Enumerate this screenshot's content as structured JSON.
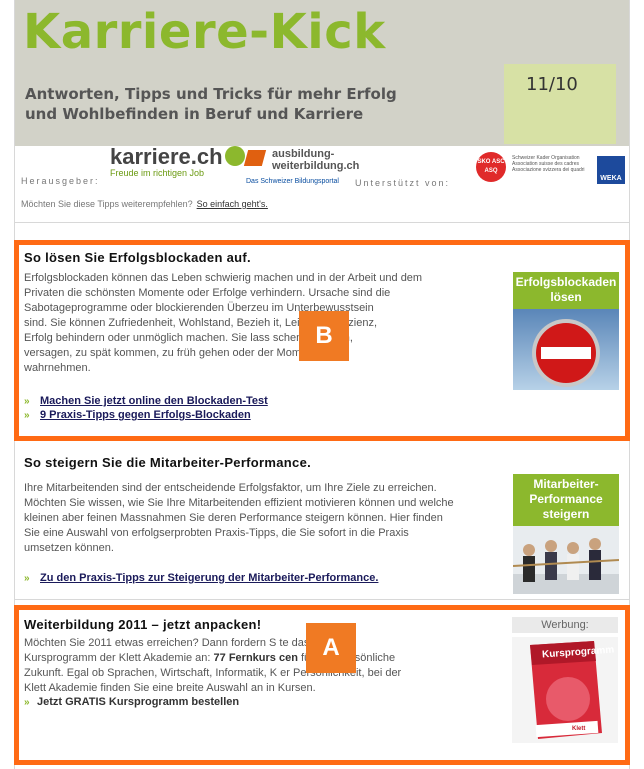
{
  "header": {
    "brand": "Karriere-Kick",
    "tagline_line1": "Antworten, Tipps und Tricks für mehr Erfolg",
    "tagline_line2": "und Wohlbefinden in Beruf und Karriere",
    "issue": "11/10"
  },
  "sponsors": {
    "publisher_label": "Herausgeber:",
    "karriere_name": "karriere.ch",
    "karriere_slogan": "Freude im richtigen Job",
    "ausbildung_line1": "ausbildung-",
    "ausbildung_line2": "weiterbildung.ch",
    "ausbildung_sub": "Das Schweizer Bildungsportal",
    "supported_label": "Unterstützt von:",
    "seal_text": "SKO ASC ASQ",
    "seal_desc": "Schweizer Kader Organisation Association suisse des cadres Associazione svizzera dei quadri",
    "weka": "WEKA"
  },
  "forward": {
    "question": "Möchten Sie diese Tipps weiterempfehlen?",
    "link": "So einfach geht's."
  },
  "section1": {
    "title": "So lösen Sie Erfolgsblockaden auf.",
    "text_lines": [
      "Erfolgsblockaden können das Leben schwierig machen und in der Arbeit und dem",
      "Privaten die schönsten Momente oder Erfolge verhindern. Ursache sind die",
      "Sabotageprogramme oder blockierenden Überzeu           im Unterbewusstsein",
      "sind. Sie können Zufriedenheit, Wohlstand, Bezieh          it, Leistung, Effizienz,",
      "Erfolg behindern oder unmöglich machen. Sie lass           schen scheitern,",
      "versagen, zu spät kommen, zu früh gehen oder der          Moment nicht",
      "wahrnehmen."
    ],
    "link1": "Machen Sie jetzt online den Blockaden-Test",
    "link2": "9 Praxis-Tipps gegen Erfolgs-Blockaden",
    "image_label": "Erfolgsblockaden lösen",
    "badge": "B"
  },
  "section2": {
    "title": "So steigern Sie die Mitarbeiter-Performance.",
    "text_lines": [
      "Ihre Mitarbeitenden sind der entscheidende Erfolgsfaktor, um Ihre Ziele zu erreichen.",
      "Möchten Sie wissen, wie Sie Ihre Mitarbeitenden effizient motivieren können und welche",
      "kleinen aber feinen Massnahmen Sie deren Performance steigern können. Hier finden",
      "Sie eine Auswahl von erfolgserprobten Praxis-Tipps, die Sie sofort in die Praxis",
      "umsetzen können."
    ],
    "link": "Zu den Praxis-Tipps zur Steigerung der Mitarbeiter-Performance.",
    "image_label": "Mitarbeiter-Performance steigern"
  },
  "section3": {
    "title": "Weiterbildung 2011 – jetzt anpacken!",
    "text_line1": "Möchten Sie 2011 etwas erreichen? Dann fordern S          te das aktuelle",
    "text_line2a": "Kursprogramm der Klett Akademie an: ",
    "text_line2b": "77 Fernkurs",
    "text_line2c": "         ",
    "text_line2d": "cen",
    "text_line2e": " für Ihre persönliche",
    "text_line3": "Zukunft. Egal ob Sprachen, Wirtschaft, Informatik, K          er Persönlichkeit, bei der",
    "text_line4": "Klett Akademie finden Sie eine breite Auswahl an in          Kursen.",
    "cta": "Jetzt GRATIS Kursprogramm bestellen",
    "ad_label": "Werbung:",
    "ad_title": "Kursprogramm",
    "ad_footer": "Klett",
    "badge": "A"
  },
  "chevron": "»",
  "colors": {
    "accent": "#8cb82d",
    "highlight": "#ff6a14",
    "badge": "#f07a23"
  }
}
